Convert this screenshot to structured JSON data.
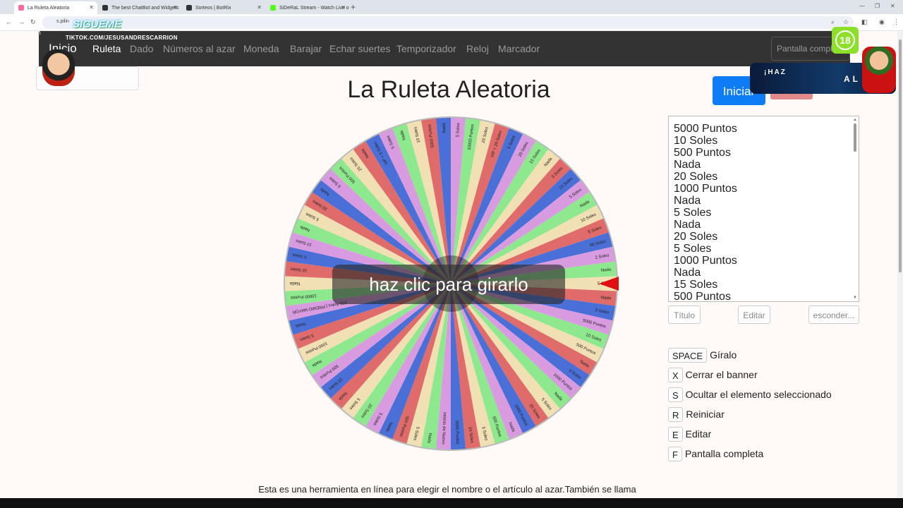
{
  "browser": {
    "tabs": [
      {
        "label": "La Ruleta Aleatoria",
        "color": "#ff6a9a",
        "active": true
      },
      {
        "label": "The best ChatBot and Widgets",
        "color": "#333333",
        "active": false
      },
      {
        "label": "Sorteos | BotRix",
        "color": "#333333",
        "active": false
      },
      {
        "label": "SiDeRaL Stream - Watch Live o",
        "color": "#53fc18",
        "active": false
      }
    ],
    "url": "s.pilin"
  },
  "overlay": {
    "sigueme": "SIGUEME",
    "tiktok_handle": "TIKTOK.COM/JESUSANDRESCARRION",
    "age_badge": "18",
    "promo_text": "¡HAZ",
    "promo_right": "AL"
  },
  "navbar": {
    "brand": "Inicio",
    "links": [
      "Ruleta",
      "Dado",
      "Números al azar",
      "Moneda",
      "Barajar",
      "Echar suertes",
      "Temporizador",
      "Reloj",
      "Marcador"
    ],
    "fullscreen_placeholder": "Pantalla completa"
  },
  "main": {
    "title": "La Ruleta Aleatoria",
    "start_button": "Iniciar",
    "spin_label": "haz clic para girarlo",
    "list_items": [
      "5000 Puntos",
      "10 Soles",
      "500 Puntos",
      "Nada",
      "20 Soles",
      "1000 Puntos",
      "Nada",
      "5 Soles",
      "Nada",
      "20 Soles",
      "5 Soles",
      "1000 Puntos",
      "Nada",
      "15 Soles",
      "500 Puntos"
    ],
    "buttons": {
      "title": "Título",
      "edit": "Editar",
      "hide": "esconder..."
    },
    "shortcuts": [
      {
        "key": "SPACE",
        "label": "Gíralo"
      },
      {
        "key": "X",
        "label": "Cerrar el banner"
      },
      {
        "key": "S",
        "label": "Ocultar el elemento seleccionado"
      },
      {
        "key": "R",
        "label": "Reiniciar"
      },
      {
        "key": "E",
        "label": "Editar"
      },
      {
        "key": "F",
        "label": "Pantalla completa"
      }
    ],
    "footer": "Esta es una herramienta en línea para elegir el nombre o el artículo al azar.También se llama"
  },
  "wheel": {
    "colors": [
      "#f2e0b5",
      "#e06b6b",
      "#4a6fd6",
      "#d99be0",
      "#8ee88e"
    ],
    "pointer_color": "#e01010",
    "labels": [
      "5 Soles",
      "Nada",
      "3 Soles",
      "5000 Puntos",
      "10 Soles",
      "500 Puntos",
      "Nada",
      "5 Soles",
      "1000 Puntos",
      "Nada",
      "5 Soles",
      "20 Soles",
      "1000 Puntos",
      "Nada",
      "500 Puntos",
      "5 Soles",
      "10 Soles",
      "5000 Puntos",
      "Intento de Nuevo",
      "Nada",
      "5 Soles",
      "500 Puntos",
      "Nada",
      "5 Soles",
      "20 Soles",
      "5 Soles",
      "Nada",
      "10 Soles",
      "500 Puntos",
      "Nada",
      "1000 Puntos",
      "5 Soles",
      "Nada",
      "200 Soles | PREMIO MAYOR",
      "10000 Puntos",
      "Nada",
      "10 Soles",
      "5 Soles",
      "10 Soles",
      "Nada",
      "5 Soles",
      "20 Soles",
      "Nada",
      "5 Soles",
      "500 Puntos",
      "20 Soles",
      "Nada",
      "VIP + 5 Soles",
      "5 Soles",
      "Nada",
      "10 Soles",
      "5000 Puntos",
      "Nada",
      "5 Soles",
      "10000 Puntos",
      "20 Soles",
      "VIP + 20 Soles",
      "5 Soles",
      "20 Soles",
      "15 Soles",
      "Nada",
      "3 Soles",
      "15 Soles",
      "5 Soles",
      "Nada",
      "10 Soles",
      "5 Soles",
      "50 Soles",
      "2 Soles",
      "Nada"
    ]
  }
}
